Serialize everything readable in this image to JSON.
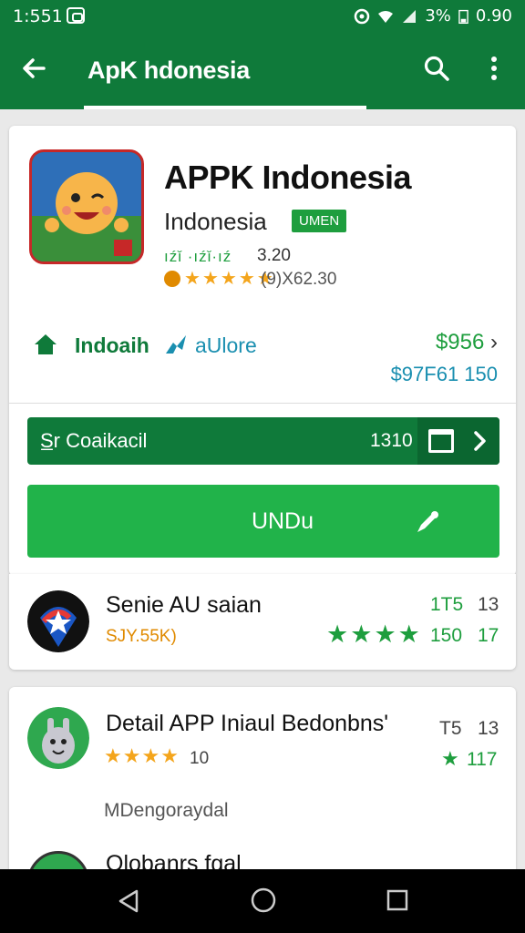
{
  "status_bar": {
    "time": "1:551",
    "battery_pct": "3%",
    "clock_right": "0.90"
  },
  "app_bar": {
    "title": "ApK hdonesia"
  },
  "app": {
    "name": "APPK Indonesia",
    "developer": "Indonesia",
    "badge": "UMEN",
    "mini_rating_text": "ıźǐ ·ıźǐ·ıź",
    "mini_rating_value": "3.20",
    "reviews": "(9)X62.30",
    "stars": 5
  },
  "tags": {
    "primary": "Indoaih",
    "secondary": "aUlore"
  },
  "prices": {
    "price1": "$956",
    "price2": "$97F61 150"
  },
  "download_bar": {
    "label": "S̲r Coaikacil",
    "size": "1310"
  },
  "install_button": {
    "label": "UNDu"
  },
  "list": [
    {
      "title": "Senie AU saian",
      "subtitle": "SJY.55K)",
      "right_top_a": "1T5",
      "right_top_b": "13",
      "right_val": "150",
      "right_val_b": "17",
      "stars": 4
    },
    {
      "title": "Detail APP Iniaul Bedonbns'",
      "subtitle": "10",
      "right_top_a": "T5",
      "right_top_b": "13",
      "right_val": "117",
      "stars": 4,
      "description": "MDengoraydal"
    },
    {
      "title": "Olobanrs fgal"
    }
  ],
  "colors": {
    "primary": "#0f7a3a",
    "accent": "#21b34a",
    "link": "#1a8fb0",
    "star": "#f4a51c",
    "green_text": "#1e9e3e"
  }
}
